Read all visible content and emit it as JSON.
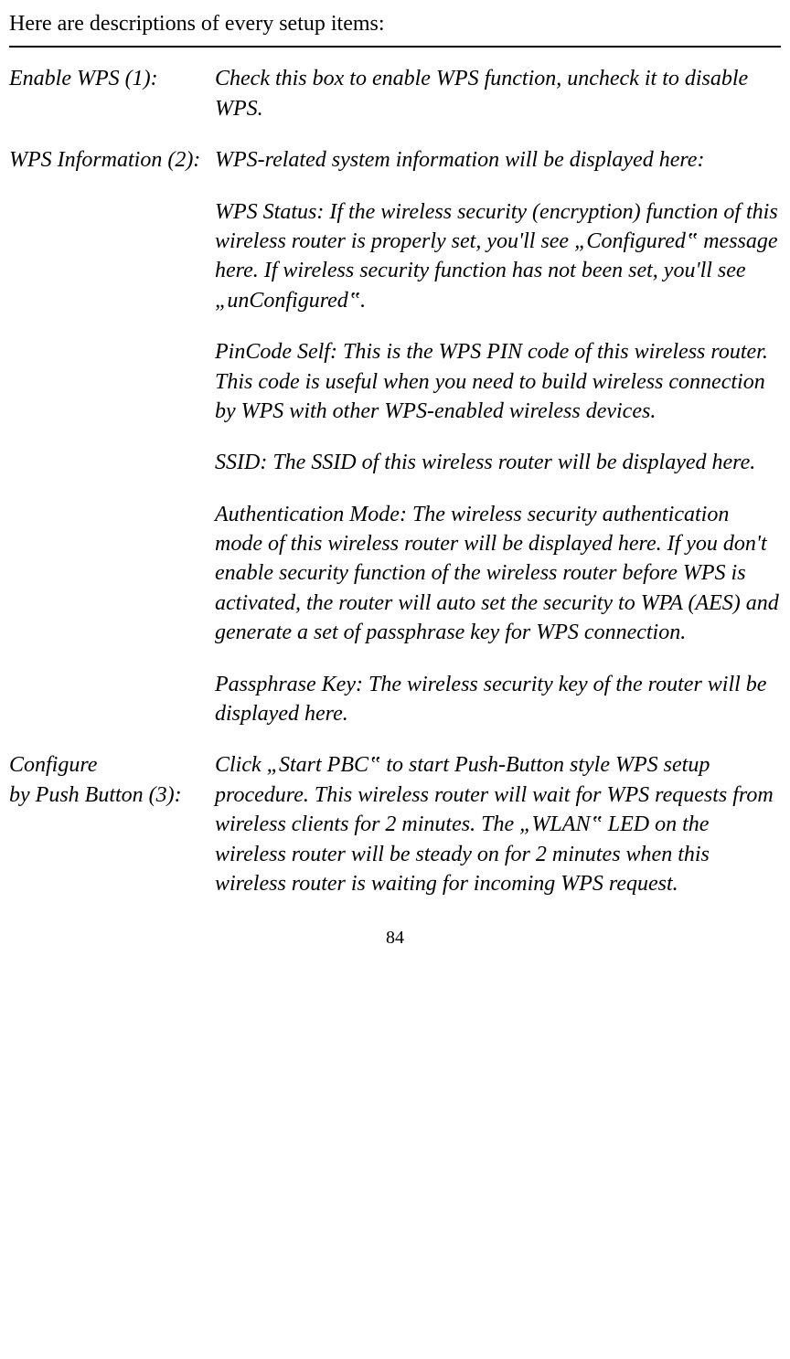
{
  "intro": "Here are descriptions of every setup items:",
  "items": [
    {
      "label": "Enable WPS (1):",
      "blocks": [
        "Check this box to enable WPS function, uncheck it to disable WPS."
      ]
    },
    {
      "label": "WPS Information (2):",
      "blocks": [
        "WPS-related system information will be displayed here:",
        "WPS Status: If the wireless security (encryption) function of this wireless router is properly set, you'll see „Configured‟ message here. If wireless security function has not been set, you'll see „unConfigured‟.",
        "PinCode Self: This is the WPS PIN code of this wireless router. This code is useful when you need to build wireless connection by WPS with other WPS-enabled wireless devices.",
        "SSID: The SSID of this wireless router will be displayed here.",
        "Authentication Mode: The wireless security authentication mode of this wireless router will be displayed here. If you don't enable security function of the wireless router before WPS is activated, the router will auto set the security to WPA (AES) and generate a set of passphrase key for WPS connection.",
        "Passphrase Key: The wireless security key of the router will be displayed here."
      ]
    },
    {
      "label": "Configure\nby Push Button (3):",
      "blocks": [
        "Click „Start PBC‟ to start Push-Button style WPS setup procedure. This wireless router will wait for WPS requests from wireless clients for 2 minutes. The „WLAN‟ LED on the wireless router will be steady on for 2 minutes when this wireless router is waiting for incoming WPS request."
      ]
    }
  ],
  "pageNumber": "84"
}
